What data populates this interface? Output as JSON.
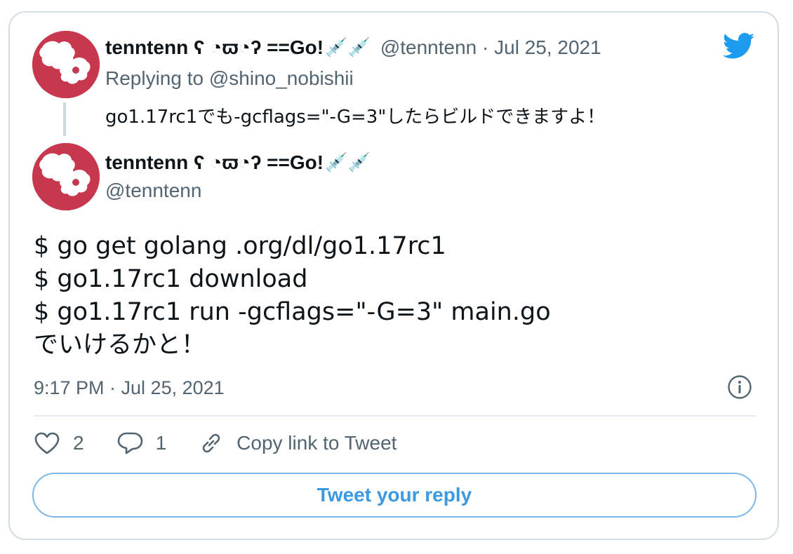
{
  "colors": {
    "accent": "#1d9bf0",
    "avatar_bg": "#c7384f",
    "muted": "#536471"
  },
  "tweet_parent": {
    "display_name": "tenntenn ʕ ◔ϖ◔ʔ ==Go!",
    "emojis": "💉💉",
    "handle_date": "@tenntenn · Jul 25, 2021",
    "replying_to": "Replying to @shino_nobishii",
    "text": "go1.17rc1でも-gcflags=\"-G=3\"したらビルドできますよ！"
  },
  "tweet_main": {
    "display_name": "tenntenn ʕ ◔ϖ◔ʔ ==Go!",
    "emojis": "💉💉",
    "handle": "@tenntenn",
    "body": "$ go get golang .org/dl/go1.17rc1\n$ go1.17rc1 download\n$ go1.17rc1 run -gcflags=\"-G=3\" main.go\nでいけるかと！",
    "timestamp": "9:17 PM · Jul 25, 2021"
  },
  "actions": {
    "like_count": "2",
    "reply_count": "1",
    "copy_link_label": "Copy link to Tweet"
  },
  "reply_button_label": "Tweet your reply",
  "icons": [
    "twitter-bird-icon",
    "heart-icon",
    "reply-icon",
    "link-icon",
    "info-icon"
  ]
}
